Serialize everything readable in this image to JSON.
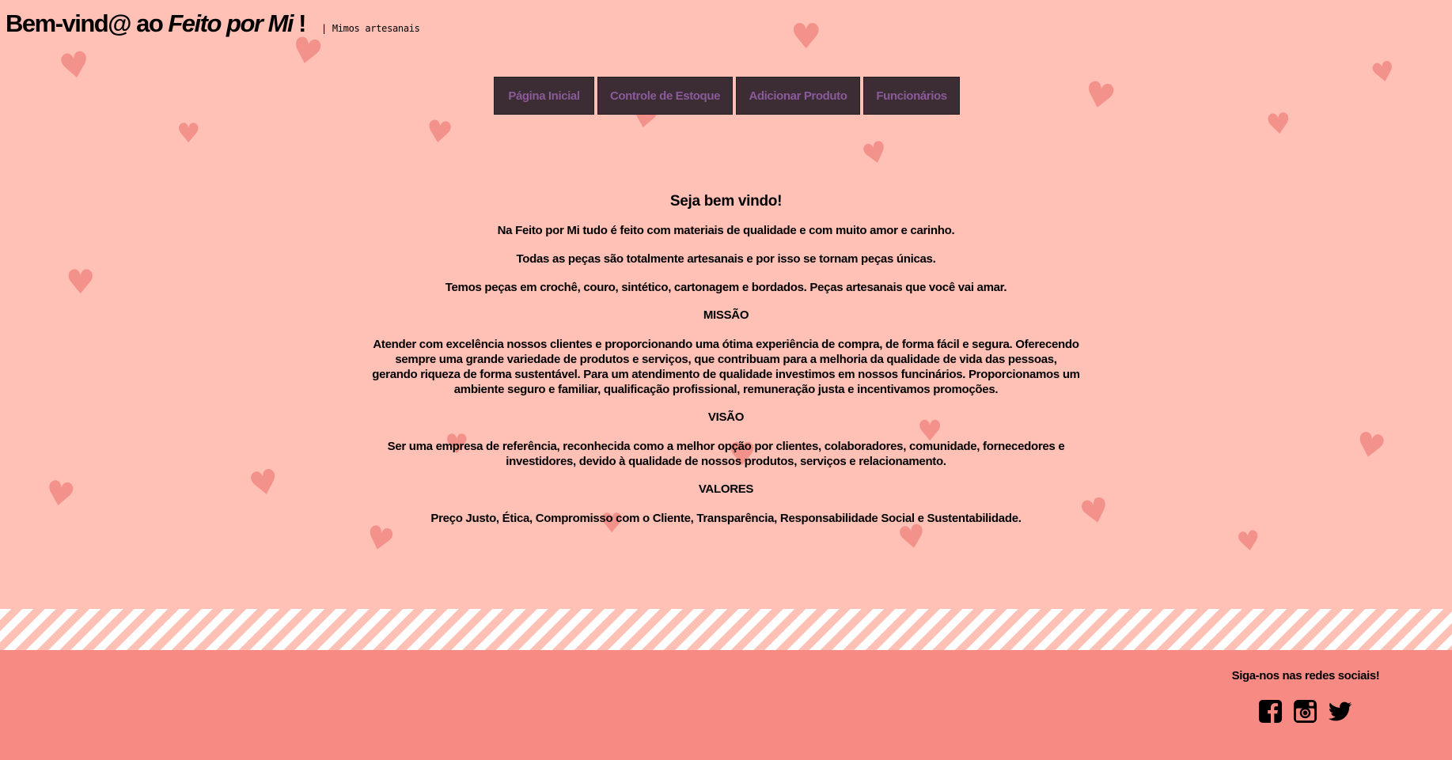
{
  "header": {
    "title_prefix": "Bem-vind@ ao ",
    "title_brand": "Feito por Mi",
    "title_suffix": " !",
    "tagline": "| Mimos artesanais"
  },
  "nav": {
    "items": [
      {
        "label": "Página Inicial"
      },
      {
        "label": "Controle de Estoque"
      },
      {
        "label": "Adicionar Produto"
      },
      {
        "label": "Funcionários"
      }
    ]
  },
  "main": {
    "welcome": "Seja bem vindo!",
    "intro": [
      "Na Feito por Mi tudo é feito com materiais de qualidade e com muito amor e carinho.",
      "Todas as peças são totalmente artesanais e por isso se tornam peças únicas.",
      "Temos peças em crochê, couro, sintético, cartonagem e bordados. Peças artesanais que você vai amar."
    ],
    "mission_title": "MISSÃO",
    "mission_text": "Atender com excelência nossos clientes e proporcionando uma ótima experiência de compra, de forma fácil e segura. Oferecendo sempre uma grande variedade de produtos e serviços, que contribuam para a melhoria da qualidade de vida das pessoas, gerando riqueza de forma sustentável. Para um atendimento de qualidade investimos em nossos funcinários. Proporcionamos um ambiente seguro e familiar, qualificação profissional, remuneração justa e incentivamos promoções.",
    "vision_title": "VISÃO",
    "vision_text": "Ser uma empresa de referência, reconhecida como a melhor opção por clientes, colaboradores, comunidade, fornecedores e investidores, devido à qualidade de nossos produtos, serviços e relacionamento.",
    "values_title": "VALORES",
    "values_text": "Preço Justo, Ética, Compromisso com o Cliente, Transparência, Responsabilidade Social e Sustentabilidade."
  },
  "footer": {
    "follow_text": "Siga-nos nas redes sociais!",
    "socials": [
      "facebook-icon",
      "instagram-icon",
      "twitter-icon"
    ]
  },
  "colors": {
    "background": "#ffc0b6",
    "heart": "#f28e86",
    "nav_bg": "#3b2d33",
    "nav_text": "#8a5a9a",
    "footer": "#f78a82"
  }
}
